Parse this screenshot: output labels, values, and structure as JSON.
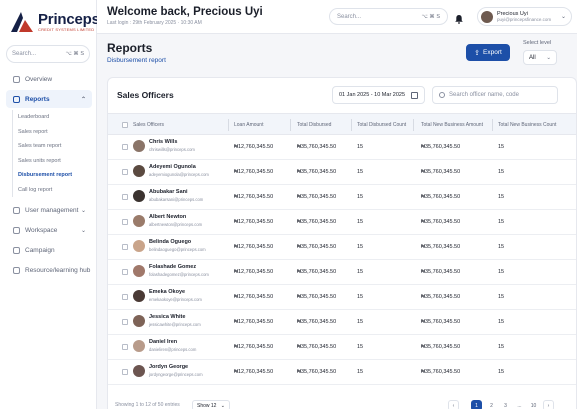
{
  "brand": {
    "name": "Princeps",
    "tagline": "CREDIT SYSTEMS LIMITED"
  },
  "sidebar": {
    "search_placeholder": "Search...",
    "search_shortcut": "⌥ ⌘ S",
    "items": [
      {
        "label": "Overview",
        "icon": "grid-icon"
      },
      {
        "label": "Reports",
        "icon": "chart-icon",
        "active": true
      },
      {
        "label": "User management",
        "icon": "users-icon"
      },
      {
        "label": "Workspace",
        "icon": "folder-icon"
      },
      {
        "label": "Campaign",
        "icon": "megaphone-icon"
      },
      {
        "label": "Resource/learning hub",
        "icon": "flag-icon"
      }
    ],
    "report_subitems": [
      "Leaderboard",
      "Sales report",
      "Sales team report",
      "Sales units report",
      "Disbursement report",
      "Call log report"
    ]
  },
  "header": {
    "welcome": "Welcome back, Precious Uyi",
    "last_login": "Last login : 29th February 2025  ·  10:30 AM",
    "search_placeholder": "Search...",
    "search_shortcut": "⌥ ⌘ S",
    "user_name": "Precious Uyi",
    "user_email": "puyi@princepsfinance.com"
  },
  "page": {
    "title": "Reports",
    "subtitle": "Disbursement report",
    "export_label": "Export",
    "level_label": "Select level",
    "level_value": "All"
  },
  "table": {
    "title": "Sales Officers",
    "date_range": "01 Jan 2025 - 10 Mar 2025",
    "search_placeholder": "Search officer name, code",
    "columns": [
      "Sales Officers",
      "Loan Amount",
      "Total Disbursed",
      "Total Disbursed Count",
      "Total New Business Amount",
      "Total New Business Count"
    ],
    "rows": [
      {
        "name": "Chris Wills",
        "email": "chriswills@princeps.com",
        "loan": "₦12,760,345.50",
        "disbursed": "₦35,760,345.50",
        "count": "15",
        "new_amount": "₦35,760,345.50",
        "new_count": "15"
      },
      {
        "name": "Adeyemi Ogunola",
        "email": "adeyemiogunola@princeps.com",
        "loan": "₦12,760,345.50",
        "disbursed": "₦35,760,345.50",
        "count": "15",
        "new_amount": "₦35,760,345.50",
        "new_count": "15"
      },
      {
        "name": "Abubakar Sani",
        "email": "abubakarsani@princeps.com",
        "loan": "₦12,760,345.50",
        "disbursed": "₦35,760,345.50",
        "count": "15",
        "new_amount": "₦35,760,345.50",
        "new_count": "15"
      },
      {
        "name": "Albert Newton",
        "email": "albertnewton@princeps.com",
        "loan": "₦12,760,345.50",
        "disbursed": "₦35,760,345.50",
        "count": "15",
        "new_amount": "₦35,760,345.50",
        "new_count": "15"
      },
      {
        "name": "Belinda Oguego",
        "email": "belindaoguego@princeps.com",
        "loan": "₦12,760,345.50",
        "disbursed": "₦35,760,345.50",
        "count": "15",
        "new_amount": "₦35,760,345.50",
        "new_count": "15"
      },
      {
        "name": "Folashade Gomez",
        "email": "folashadegomez@princeps.com",
        "loan": "₦12,760,345.50",
        "disbursed": "₦35,760,345.50",
        "count": "15",
        "new_amount": "₦35,760,345.50",
        "new_count": "15"
      },
      {
        "name": "Emeka Okoye",
        "email": "emekaokoye@princeps.com",
        "loan": "₦12,760,345.50",
        "disbursed": "₦35,760,345.50",
        "count": "15",
        "new_amount": "₦35,760,345.50",
        "new_count": "15"
      },
      {
        "name": "Jessica White",
        "email": "jessicawhite@princeps.com",
        "loan": "₦12,760,345.50",
        "disbursed": "₦35,760,345.50",
        "count": "15",
        "new_amount": "₦35,760,345.50",
        "new_count": "15"
      },
      {
        "name": "Daniel Iren",
        "email": "danieliren@princeps.com",
        "loan": "₦12,760,345.50",
        "disbursed": "₦35,760,345.50",
        "count": "15",
        "new_amount": "₦35,760,345.50",
        "new_count": "15"
      },
      {
        "name": "Jordyn George",
        "email": "jordyngeorge@princeps.com",
        "loan": "₦12,760,345.50",
        "disbursed": "₦35,760,345.50",
        "count": "15",
        "new_amount": "₦35,760,345.50",
        "new_count": "15"
      }
    ],
    "avatar_colors": [
      "#8a7468",
      "#5b4a40",
      "#3b3330",
      "#9a7b6a",
      "#c9a48a",
      "#a0786a",
      "#4a3a35",
      "#7e6357",
      "#b89b8a",
      "#6c5550"
    ],
    "footer_info": "Showing 1 to 12 of 50 entries",
    "page_size": "Show 12",
    "pages": [
      "1",
      "2",
      "3",
      "...",
      "10"
    ],
    "current_page": "1"
  },
  "colors": {
    "accent": "#1d4fa8",
    "brand_navy": "#152046",
    "brand_red": "#c0392b"
  }
}
